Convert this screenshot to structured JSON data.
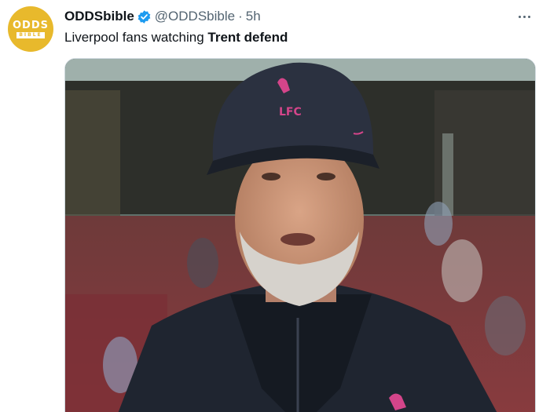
{
  "avatar": {
    "brand_top": "ODDS",
    "brand_bottom": "BIBLE",
    "color": "#e8b92c"
  },
  "author": {
    "display_name": "ODDSbible",
    "verified_icon": "verified-badge-icon",
    "handle": "@ODDSbible",
    "separator": "·",
    "timestamp": "5h"
  },
  "tweet": {
    "text_plain": "Liverpool fans watching ",
    "text_bold": "Trent defend"
  },
  "media": {
    "cap_badge": "LFC",
    "accent": "#d4458a"
  },
  "colors": {
    "primary_text": "#0f1419",
    "secondary_text": "#536471",
    "verified_blue": "#1d9bf0"
  }
}
